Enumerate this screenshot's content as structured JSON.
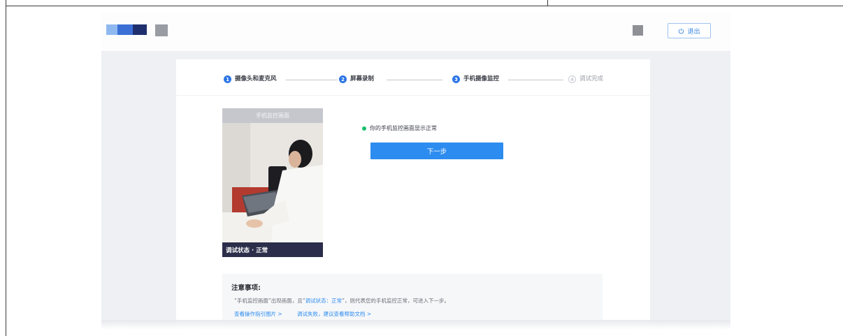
{
  "header": {
    "exit_label": "退出",
    "logo_icon": "brand-logo",
    "exit_icon": "power-icon"
  },
  "steps": [
    {
      "num": "1",
      "label": "摄像头和麦克风",
      "state": "active"
    },
    {
      "num": "2",
      "label": "屏幕录制",
      "state": "active"
    },
    {
      "num": "3",
      "label": "手机摄像监控",
      "state": "active"
    },
    {
      "num": "4",
      "label": "调试完成",
      "state": "pending"
    }
  ],
  "preview": {
    "title": "手机监控画面",
    "status": "调试状态 · 正常"
  },
  "status_message": "你的手机监控画面显示正常",
  "next_label": "下一步",
  "notes": {
    "title": "注意事项:",
    "line_prefix": "“手机监控画面”出现画面，且“",
    "highlight": "调试状态：正常",
    "line_suffix": "”，则代表您的手机监控正常，可进入下一步。",
    "link_guide": "查看操作指引图片 >",
    "link_help": "调试失败，建议查看帮助文档 >"
  },
  "colors": {
    "accent": "#2d8cf0",
    "success": "#19be6b",
    "status_bar": "#2b2d4a",
    "page_bg": "#eef0f3"
  }
}
